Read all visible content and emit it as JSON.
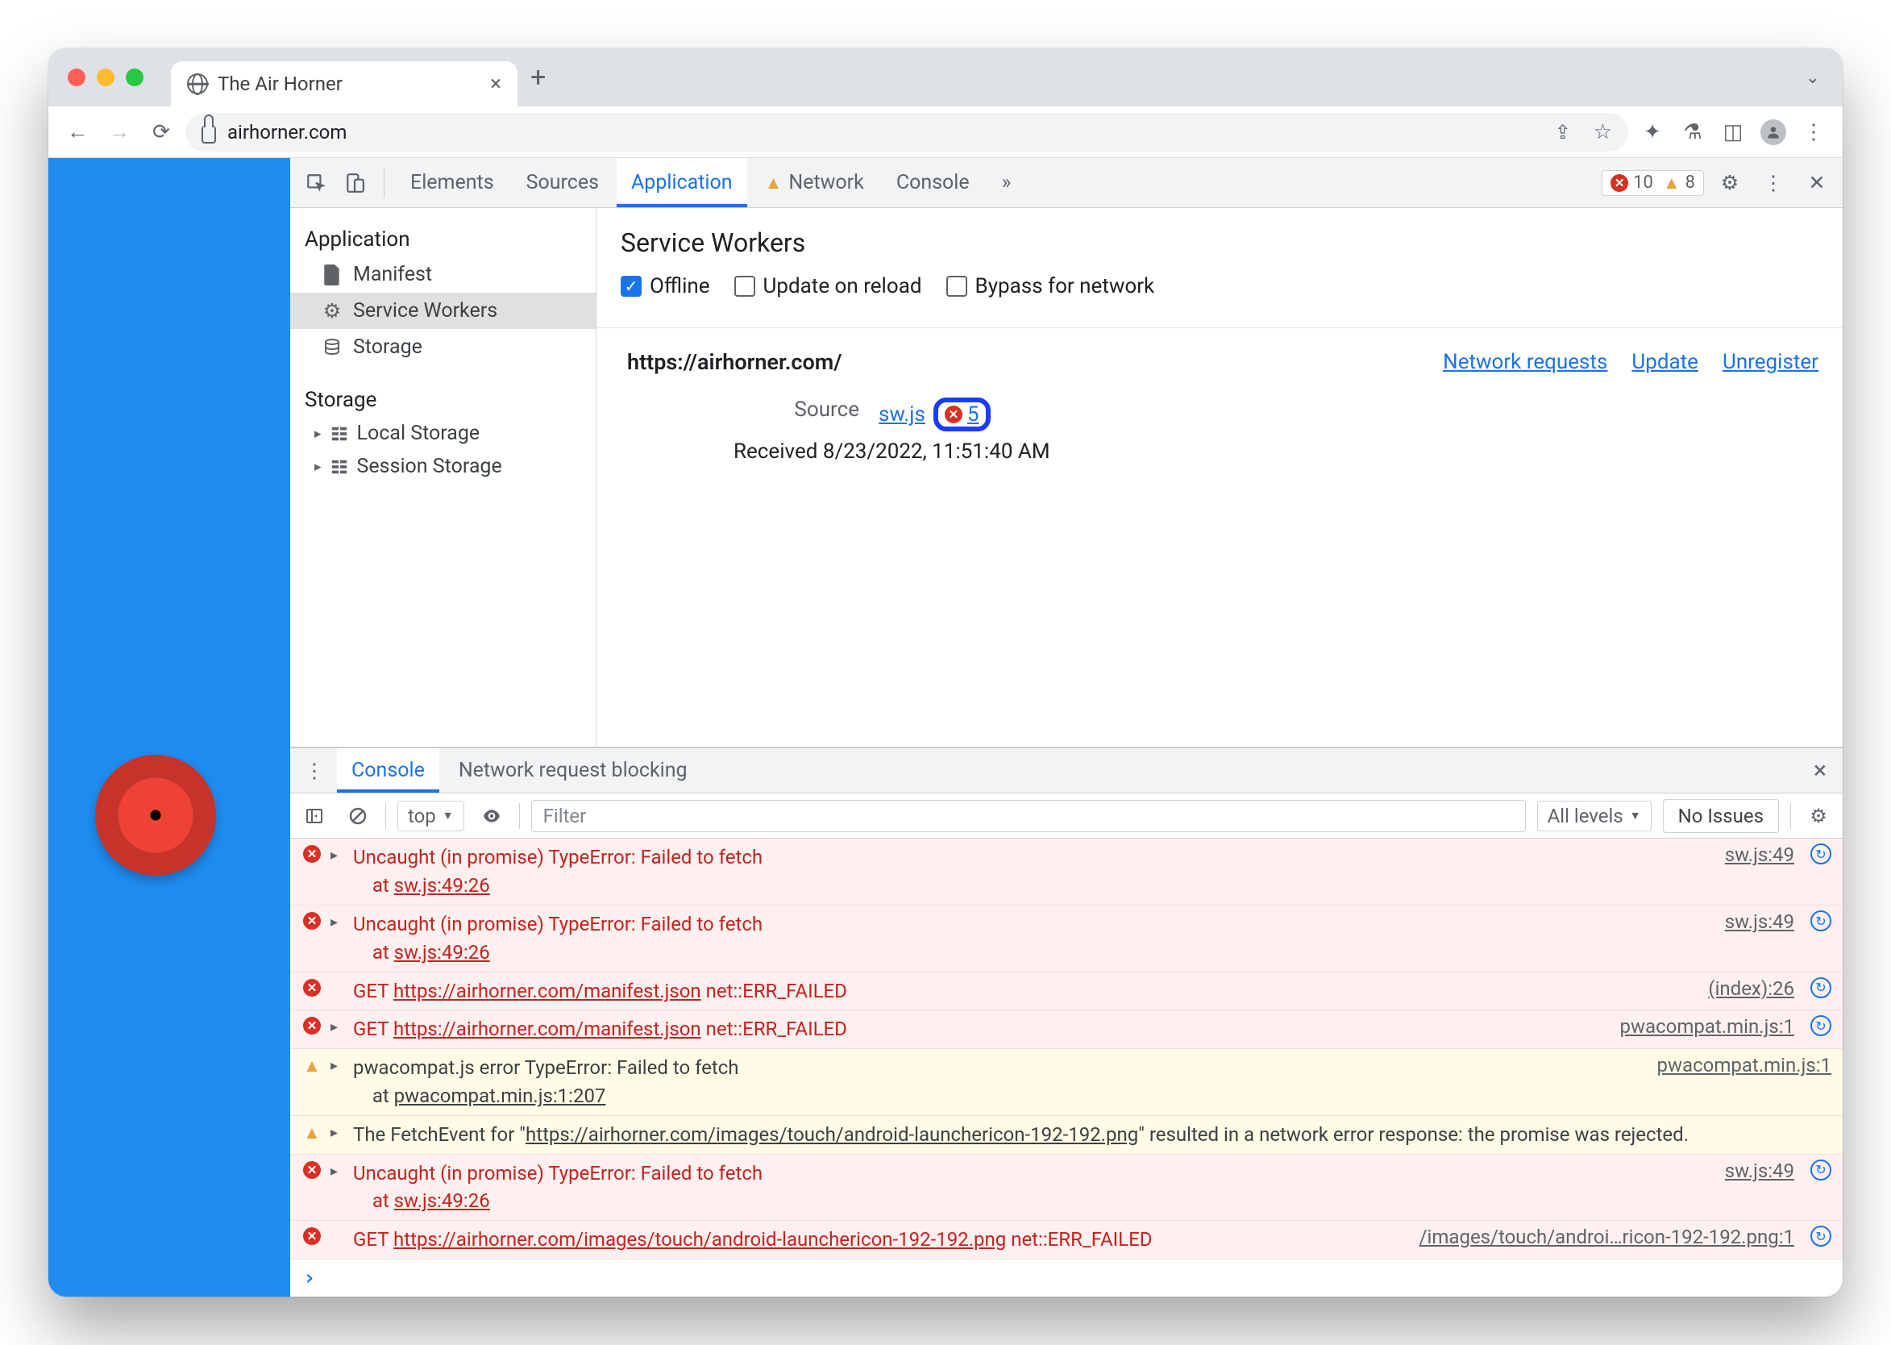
{
  "browser": {
    "tab_title": "The Air Horner",
    "url": "airhorner.com"
  },
  "devtools": {
    "tabs": [
      "Elements",
      "Sources",
      "Application",
      "Network",
      "Console"
    ],
    "active_tab": "Application",
    "overflow": "»",
    "error_count": "10",
    "warning_count": "8"
  },
  "sidebar": {
    "section_app": "Application",
    "items_app": [
      "Manifest",
      "Service Workers",
      "Storage"
    ],
    "section_storage": "Storage",
    "items_storage": [
      "Local Storage",
      "Session Storage"
    ]
  },
  "sw_panel": {
    "title": "Service Workers",
    "checks": {
      "offline": "Offline",
      "update": "Update on reload",
      "bypass": "Bypass for network"
    },
    "origin": "https://airhorner.com/",
    "links": {
      "net": "Network requests",
      "update": "Update",
      "unreg": "Unregister"
    },
    "source_label": "Source",
    "source_file": "sw.js",
    "source_err_count": "5",
    "received_label": "Received",
    "received_value": "8/23/2022, 11:51:40 AM"
  },
  "drawer": {
    "tabs": [
      "Console",
      "Network request blocking"
    ],
    "context": "top",
    "filter_placeholder": "Filter",
    "levels": "All levels",
    "issues": "No Issues"
  },
  "console": [
    {
      "type": "err",
      "expand": true,
      "msg": "Uncaught (in promise) TypeError: Failed to fetch\n    at ",
      "link_inline": "sw.js:49:26",
      "src": "sw.js:49",
      "cycle": true
    },
    {
      "type": "err",
      "expand": true,
      "msg": "Uncaught (in promise) TypeError: Failed to fetch\n    at ",
      "link_inline": "sw.js:49:26",
      "src": "sw.js:49",
      "cycle": true
    },
    {
      "type": "err",
      "expand": false,
      "pre": "GET ",
      "url": "https://airhorner.com/manifest.json",
      "post": " net::ERR_FAILED",
      "src": "(index):26",
      "cycle": true
    },
    {
      "type": "err",
      "expand": true,
      "pre": "GET ",
      "url": "https://airhorner.com/manifest.json",
      "post": " net::ERR_FAILED",
      "src": "pwacompat.min.js:1",
      "cycle": true
    },
    {
      "type": "warn",
      "expand": true,
      "msg": "pwacompat.js error TypeError: Failed to fetch\n    at ",
      "link_inline": "pwacompat.min.js:1:207",
      "src": "pwacompat.min.js:1"
    },
    {
      "type": "warn",
      "expand": true,
      "msg": "The FetchEvent for \"",
      "url": "https://airhorner.com/images/touch/android-launchericon-192-192.png",
      "post": "\" resulted in a network error response: the promise was rejected."
    },
    {
      "type": "err",
      "expand": true,
      "msg": "Uncaught (in promise) TypeError: Failed to fetch\n    at ",
      "link_inline": "sw.js:49:26",
      "src": "sw.js:49",
      "cycle": true
    },
    {
      "type": "err",
      "expand": false,
      "pre": "GET ",
      "url": "https://airhorner.com/images/touch/android-launchericon-192-192.png",
      "post": " net::ERR_FAILED",
      "src": "/images/touch/androi…ricon-192-192.png:1",
      "cycle": true
    }
  ]
}
